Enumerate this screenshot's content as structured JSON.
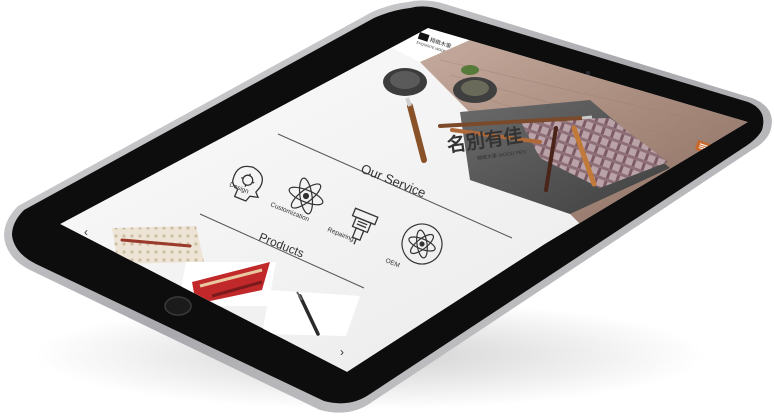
{
  "header": {
    "logo_text": "精緻木筆",
    "logo_subtitle": "EXQUISITE WOOD PEN"
  },
  "hero": {
    "calligraphy_text": "名別有佳",
    "calligraphy_sub": "精緻木筆 WOOD PEN"
  },
  "menu": {
    "icon": "menu-icon"
  },
  "services": {
    "title": "Our Service",
    "items": [
      {
        "label": "Design",
        "icon": "head-gear-icon"
      },
      {
        "label": "Customization",
        "icon": "atom-icon"
      },
      {
        "label": "Repairing",
        "icon": "machine-icon"
      },
      {
        "label": "OEM",
        "icon": "circle-atom-icon"
      }
    ]
  },
  "products": {
    "title": "Products",
    "items": [
      {
        "name": "",
        "icon": "pen-on-pattern"
      },
      {
        "name": "",
        "icon": "red-pens"
      },
      {
        "name": "",
        "icon": "dark-pen"
      }
    ]
  },
  "nav": {
    "prev_icon": "chevron-left-icon",
    "next_icon": "chevron-right-icon"
  },
  "colors": {
    "bezel": "#0d0d0d",
    "rim": "#b9b9bd",
    "screen_bg": "#f2f2f2",
    "hero_wood": "#b69a8c",
    "accent_red": "#c0282a"
  }
}
